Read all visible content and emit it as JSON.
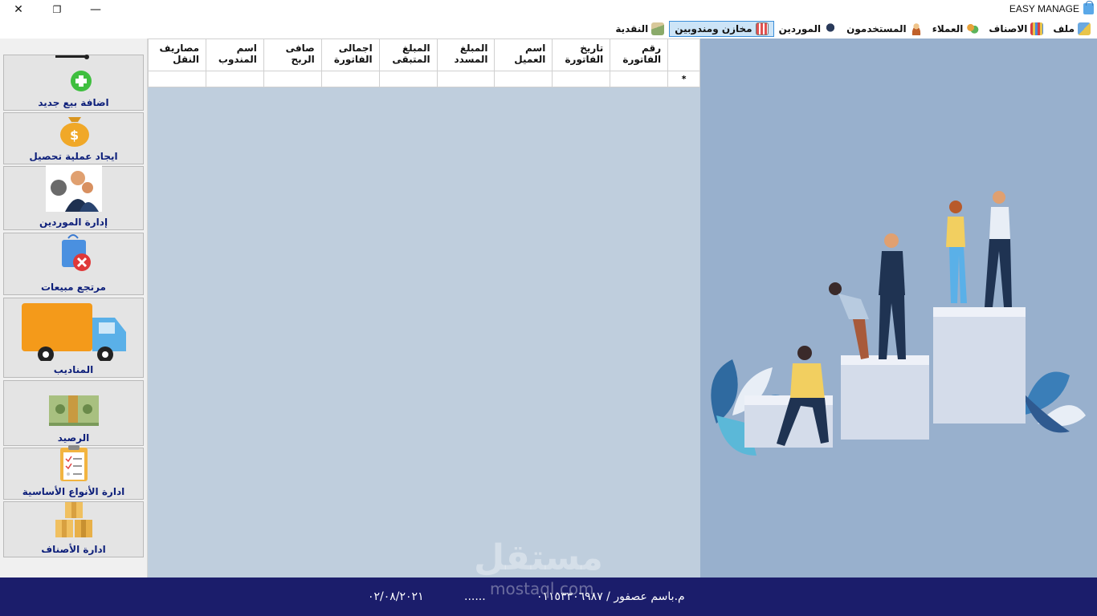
{
  "window": {
    "title": "EASY MANAGE",
    "close_glyph": "✕",
    "restore_glyph": "❐",
    "minimize_glyph": "—"
  },
  "menu": [
    {
      "label": "ملف",
      "icon": "file-menu-icon"
    },
    {
      "label": "الاصناف",
      "icon": "items-menu-icon"
    },
    {
      "label": "العملاء",
      "icon": "customers-menu-icon"
    },
    {
      "label": "المستخدمون",
      "icon": "users-menu-icon"
    },
    {
      "label": "الموردين",
      "icon": "suppliers-menu-icon"
    },
    {
      "label": "مخازن ومندوبين",
      "icon": "stores-menu-icon",
      "active": true
    },
    {
      "label": "النقدية",
      "icon": "cash-menu-icon"
    }
  ],
  "sidebar": {
    "buttons": [
      {
        "label": "اضافة بيع جديد",
        "icon": "add-sale-icon"
      },
      {
        "label": "ايجاد عملية تحصيل",
        "icon": "money-bag-icon"
      },
      {
        "label": "إدارة الموردين",
        "icon": "suppliers-people-icon"
      },
      {
        "label": "مرتجع مبيعات",
        "icon": "sales-return-icon"
      },
      {
        "label": "المناديب",
        "icon": "delivery-truck-icon"
      },
      {
        "label": "الرصيد",
        "icon": "cash-stack-icon"
      },
      {
        "label": "ادارة الأنواع الأساسية",
        "icon": "clipboard-icon"
      },
      {
        "label": "ادارة الأصناف",
        "icon": "boxes-icon"
      }
    ]
  },
  "grid": {
    "columns": [
      [
        "رقم",
        "الفاتورة"
      ],
      [
        "تاريخ",
        "الفاتورة"
      ],
      [
        "اسم",
        "العميل"
      ],
      [
        "المبلغ",
        "المسدد"
      ],
      [
        "المبلغ",
        "المتبقى"
      ],
      [
        "اجمالى",
        "الفاتورة"
      ],
      [
        "صافى",
        "الربح"
      ],
      [
        "اسم",
        "المندوب"
      ],
      [
        "مصاريف",
        "النقل"
      ]
    ],
    "new_row_marker": "*"
  },
  "footer": {
    "contact": "م.باسم عصفور / ٠١١٥٣٣٠٦٩٨٧",
    "dots": "......",
    "date": "٠٢/٠٨/٢٠٢١"
  },
  "watermark": {
    "text": "مستقل",
    "domain": "mostaql.com"
  },
  "colors": {
    "footer_bg": "#1b1d6b",
    "grid_bg": "#bfcedd",
    "illustration_bg": "#98b0cd",
    "sidebar_label": "#0d1f7a",
    "menu_active": "#cce4f7"
  }
}
